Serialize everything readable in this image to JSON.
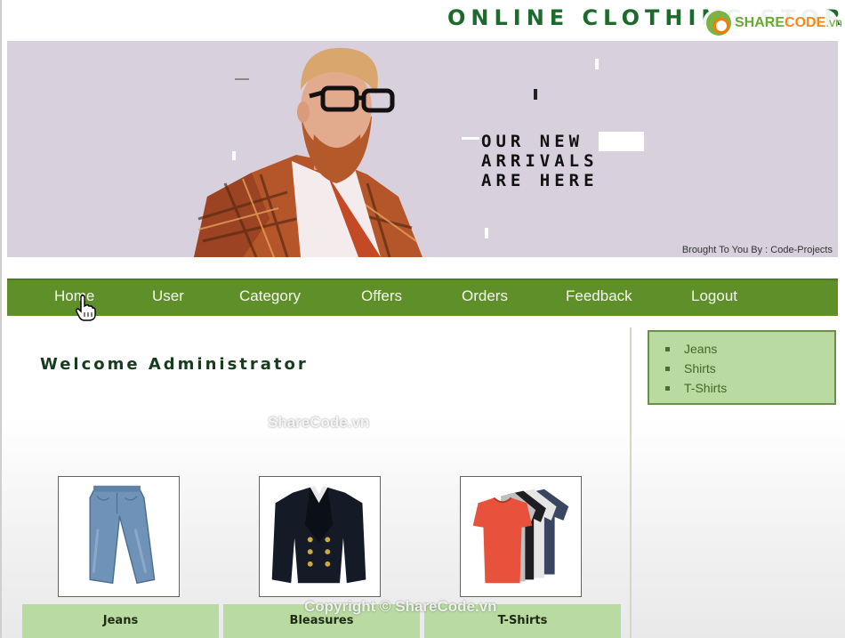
{
  "header": {
    "title": "ONLINE CLOTHING STORE"
  },
  "watermark": {
    "logo_share": "SHARE",
    "logo_code": "CODE",
    "logo_vn": ".vn",
    "center_text": "ShareCode.vn",
    "bottom_text": "Copyright © ShareCode.vn"
  },
  "banner": {
    "tagline_line1": "OUR NEW",
    "tagline_line2": "ARRIVALS",
    "tagline_line3": "ARE HERE",
    "credit": "Brought To You By : Code-Projects",
    "background_color": "#d8d0dc"
  },
  "nav": {
    "items": [
      {
        "label": "Home"
      },
      {
        "label": "User"
      },
      {
        "label": "Category"
      },
      {
        "label": "Offers"
      },
      {
        "label": "Orders"
      },
      {
        "label": "Feedback"
      },
      {
        "label": "Logout"
      }
    ],
    "background_color": "#5f8f29"
  },
  "main": {
    "welcome": "Welcome Administrator",
    "products": [
      {
        "name": "Jeans",
        "icon": "jeans-image"
      },
      {
        "name": "Bleasures",
        "icon": "blazer-image"
      },
      {
        "name": "T-Shirts",
        "icon": "tshirts-image"
      }
    ]
  },
  "sidebar": {
    "categories": [
      {
        "label": "Jeans"
      },
      {
        "label": "Shirts"
      },
      {
        "label": "T-Shirts"
      }
    ],
    "background_color": "#b9dba2"
  }
}
